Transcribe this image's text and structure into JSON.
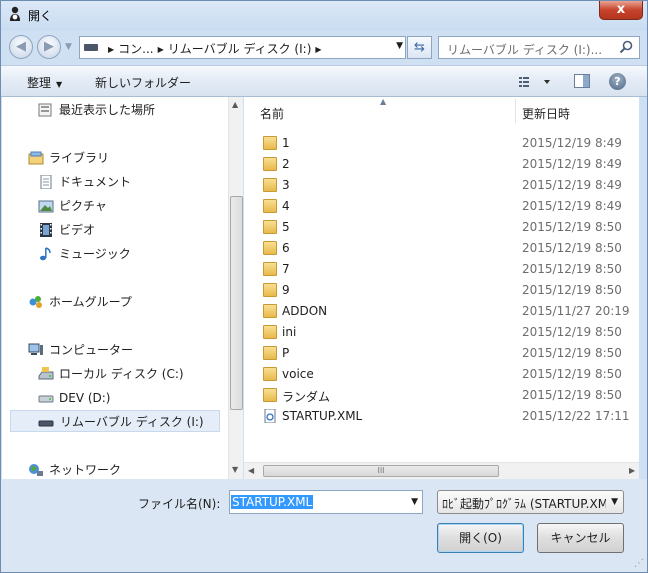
{
  "window": {
    "title": "開く",
    "close_label": "x"
  },
  "nav": {
    "address_parts": [
      "コン...",
      "リムーバブル ディスク (I:)"
    ],
    "search_placeholder": "リムーバブル ディスク (I:)..."
  },
  "toolbar": {
    "organize_label": "整理",
    "new_folder_label": "新しいフォルダー"
  },
  "navpane": {
    "items": [
      {
        "label": "最近表示した場所",
        "icon": "recent-places-icon"
      },
      {
        "label": "ライブラリ",
        "icon": "library-icon"
      },
      {
        "label": "ドキュメント",
        "icon": "documents-icon"
      },
      {
        "label": "ピクチャ",
        "icon": "pictures-icon"
      },
      {
        "label": "ビデオ",
        "icon": "video-icon"
      },
      {
        "label": "ミュージック",
        "icon": "music-icon"
      },
      {
        "label": "ホームグループ",
        "icon": "homegroup-icon"
      },
      {
        "label": "コンピューター",
        "icon": "computer-icon"
      },
      {
        "label": "ローカル ディスク (C:)",
        "icon": "local-disk-icon"
      },
      {
        "label": "DEV (D:)",
        "icon": "drive-icon"
      },
      {
        "label": "リムーバブル ディスク (I:)",
        "icon": "removable-drive-icon"
      },
      {
        "label": "ネットワーク",
        "icon": "network-icon"
      }
    ]
  },
  "filelist": {
    "col_name": "名前",
    "col_date": "更新日時",
    "scroll_grip": "III",
    "files": [
      {
        "name": "1",
        "date": "2015/12/19 8:49",
        "type": "folder"
      },
      {
        "name": "2",
        "date": "2015/12/19 8:49",
        "type": "folder"
      },
      {
        "name": "3",
        "date": "2015/12/19 8:49",
        "type": "folder"
      },
      {
        "name": "4",
        "date": "2015/12/19 8:49",
        "type": "folder"
      },
      {
        "name": "5",
        "date": "2015/12/19 8:50",
        "type": "folder"
      },
      {
        "name": "6",
        "date": "2015/12/19 8:50",
        "type": "folder"
      },
      {
        "name": "7",
        "date": "2015/12/19 8:50",
        "type": "folder"
      },
      {
        "name": "9",
        "date": "2015/12/19 8:50",
        "type": "folder"
      },
      {
        "name": "ADDON",
        "date": "2015/11/27 20:19",
        "type": "folder"
      },
      {
        "name": "ini",
        "date": "2015/12/19 8:50",
        "type": "folder"
      },
      {
        "name": "P",
        "date": "2015/12/19 8:50",
        "type": "folder"
      },
      {
        "name": "voice",
        "date": "2015/12/19 8:50",
        "type": "folder"
      },
      {
        "name": "ランダム",
        "date": "2015/12/19 8:50",
        "type": "folder"
      },
      {
        "name": "STARTUP.XML",
        "date": "2015/12/22 17:11",
        "type": "xml"
      }
    ]
  },
  "bottom": {
    "filename_label": "ファイル名(N):",
    "filename_value": "STARTUP.XML",
    "filter_value": "ﾛﾋﾞ起動ﾌﾟﾛｸﾞﾗﾑ (STARTUP.XML)",
    "open_label": "開く(O)",
    "cancel_label": "キャンセル"
  }
}
